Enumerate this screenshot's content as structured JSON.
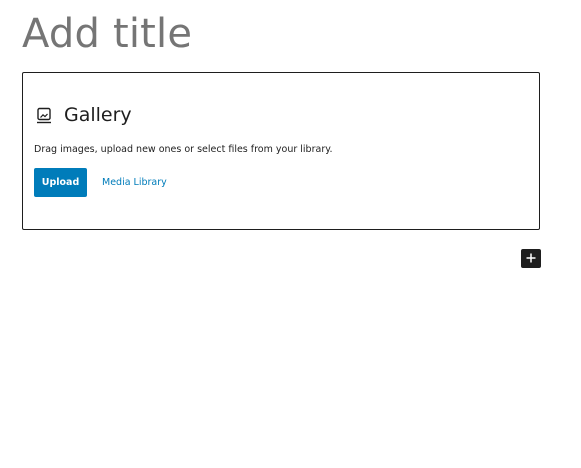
{
  "editor": {
    "title_placeholder": "Add title"
  },
  "gallery_block": {
    "title": "Gallery",
    "icon": "gallery-icon",
    "instructions": "Drag images, upload new ones or select files from your library.",
    "upload_label": "Upload",
    "media_library_label": "Media Library"
  },
  "inserter": {
    "icon": "plus-icon"
  },
  "colors": {
    "accent": "#007cba",
    "text": "#1e1e1e",
    "title_placeholder": "#757575"
  }
}
